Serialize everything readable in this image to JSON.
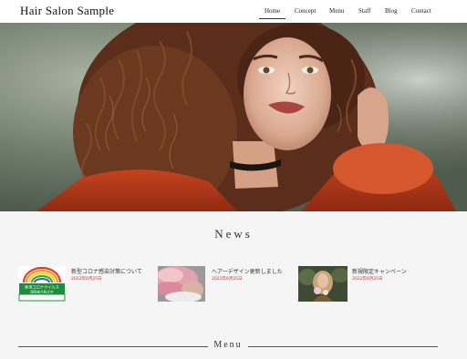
{
  "header": {
    "logo": "Hair Salon Sample",
    "nav": [
      {
        "label": "Home",
        "active": true
      },
      {
        "label": "Concept"
      },
      {
        "label": "Menu"
      },
      {
        "label": "Staff"
      },
      {
        "label": "Blog"
      },
      {
        "label": "Contact"
      }
    ]
  },
  "hero": {
    "image": "curly-haired-woman-portrait"
  },
  "news": {
    "title": "News",
    "items": [
      {
        "title": "新型コロナ感染対策について",
        "date": "2022年6月25日",
        "thumb": "covid-prevention-sign",
        "thumb_text": [
          "新型コロナウイルス",
          "感染拡大防止中"
        ]
      },
      {
        "title": "ヘアーデザイン更新しました",
        "date": "2022年6月25日",
        "thumb": "pink-hair-photo"
      },
      {
        "title": "新規限定キャンペーン",
        "date": "2022年6月25日",
        "thumb": "woman-with-flowers-photo"
      }
    ]
  },
  "menu_section": {
    "title": "Menu"
  },
  "colors": {
    "date_red": "#c7302f",
    "background": "#f5f5f5"
  }
}
